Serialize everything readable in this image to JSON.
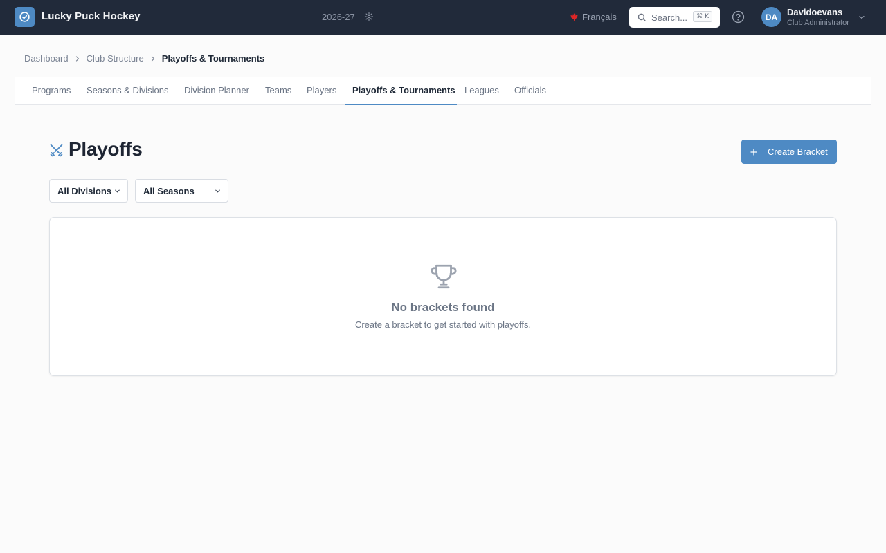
{
  "header": {
    "brand": "Lucky Puck Hockey",
    "season": "2026-27",
    "language": "Français",
    "search_placeholder": "Search...",
    "search_shortcut": "⌘ K",
    "user": {
      "initials": "DA",
      "name": "Davidoevans",
      "role": "Club Administrator"
    }
  },
  "breadcrumb": [
    "Dashboard",
    "Club Structure",
    "Playoffs & Tournaments"
  ],
  "tabs": [
    {
      "label": "Programs",
      "active": false
    },
    {
      "label": "Seasons & Divisions",
      "active": false
    },
    {
      "label": "Division Planner",
      "active": false
    },
    {
      "label": "Teams",
      "active": false
    },
    {
      "label": "Players",
      "active": false
    },
    {
      "label": "Playoffs & Tournaments",
      "active": true
    },
    {
      "label": "Leagues",
      "active": false
    },
    {
      "label": "Officials",
      "active": false
    }
  ],
  "page": {
    "title": "Playoffs",
    "create_button": "Create Bracket"
  },
  "filters": {
    "division": "All Divisions",
    "season": "All Seasons"
  },
  "empty_state": {
    "title": "No brackets found",
    "subtitle": "Create a bracket to get started with playoffs."
  },
  "colors": {
    "navbar": "#212a3a",
    "accent": "#4e8ac4"
  }
}
